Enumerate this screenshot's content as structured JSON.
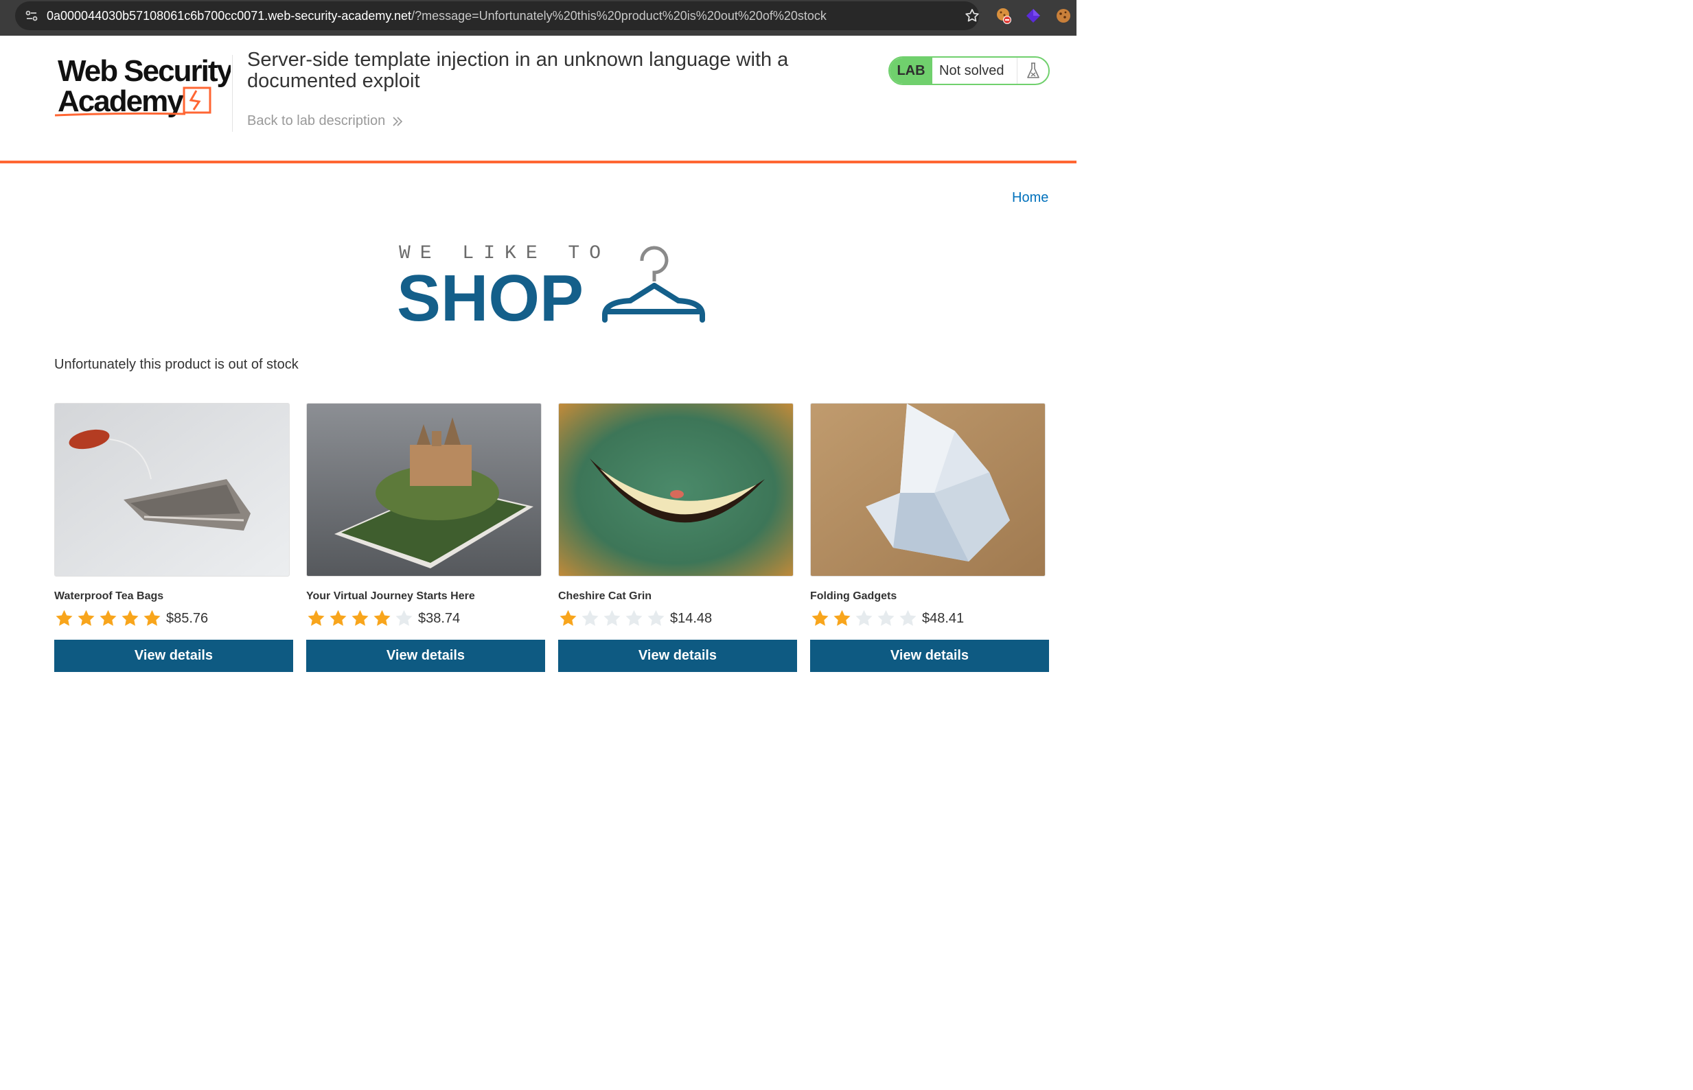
{
  "browser": {
    "url_host": "0a000044030b57108061c6b700cc0071.web-security-academy.net",
    "url_rest": "/?message=Unfortunately%20this%20product%20is%20out%20of%20stock"
  },
  "lab": {
    "logo_line1": "Web Security",
    "logo_line2": "Academy",
    "title": "Server-side template injection in an unknown language with a documented exploit",
    "back_label": "Back to lab description",
    "badge": "LAB",
    "status": "Not solved",
    "accent_color": "#ff6633",
    "status_color": "#70d06d"
  },
  "nav": {
    "home_label": "Home"
  },
  "shop_logo": {
    "tagline": "WE LIKE TO",
    "word": "SHOP"
  },
  "message": "Unfortunately this product is out of stock",
  "products": [
    {
      "name": "Waterproof Tea Bags",
      "rating": 5,
      "price": "$85.76",
      "button": "View details"
    },
    {
      "name": "Your Virtual Journey Starts Here",
      "rating": 4,
      "price": "$38.74",
      "button": "View details"
    },
    {
      "name": "Cheshire Cat Grin",
      "rating": 1,
      "price": "$14.48",
      "button": "View details"
    },
    {
      "name": "Folding Gadgets",
      "rating": 2,
      "price": "$48.41",
      "button": "View details"
    }
  ],
  "colors": {
    "button": "#0e5a82",
    "star_on": "#f8a51c",
    "star_off": "#e6ebee",
    "link": "#0071bc"
  }
}
